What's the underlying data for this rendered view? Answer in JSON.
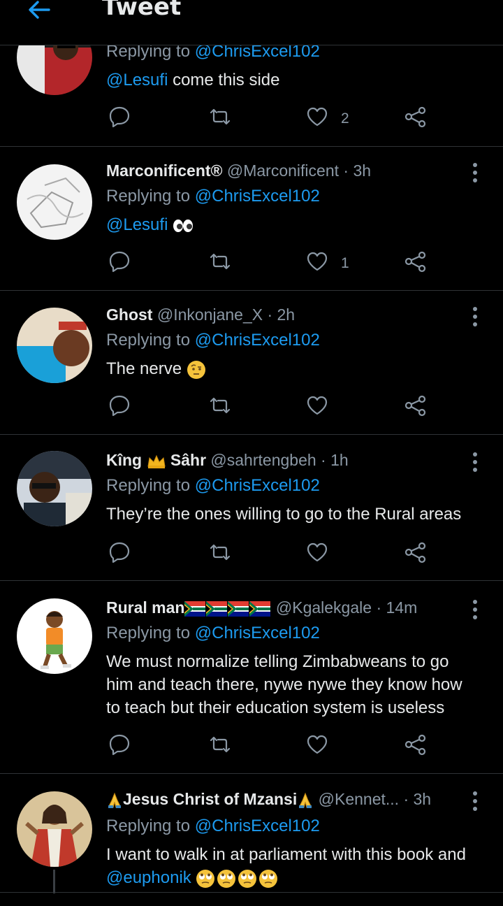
{
  "header": {
    "title": "Tweet",
    "back_icon": "arrow-left-icon",
    "accent": "#1d9bf0"
  },
  "colors": {
    "background": "#000000",
    "text": "#e7e9ea",
    "muted": "#8b98a5",
    "link": "#1d9bf0",
    "divider": "#2f3336"
  },
  "tweets": [
    {
      "replying_prefix": "Replying to",
      "replying_to": "@ChrisExcel102",
      "mention": "@Lesufi",
      "text": " come this side",
      "likes": "2"
    },
    {
      "name": "Marconificent®",
      "handle": "@Marconificent",
      "time": "· 3h",
      "replying_prefix": "Replying to",
      "replying_to": "@ChrisExcel102",
      "mention": "@Lesufi",
      "emoji": "eyes",
      "likes": "1"
    },
    {
      "name": "Ghost",
      "handle": "@Inkonjane_X",
      "time": "· 2h",
      "replying_prefix": "Replying to",
      "replying_to": "@ChrisExcel102",
      "text": "The nerve",
      "emoji": "face-with-raised-eyebrow"
    },
    {
      "name_a": "Kîng",
      "name_b": "Sâhr",
      "emoji": "crown",
      "handle": "@sahrtengbeh",
      "time": "· 1h",
      "replying_prefix": "Replying to",
      "replying_to": "@ChrisExcel102",
      "text": "They’re the ones willing to go to the Rural areas"
    },
    {
      "name": "Rural man",
      "emoji": "south-africa-flag x4",
      "handle": "@Kgalekgale",
      "time": "· 14m",
      "replying_prefix": "Replying to",
      "replying_to": "@ChrisExcel102",
      "text_lines": [
        "We must normalize telling Zimbabweans to go",
        "him and teach there, nywe nywe they know how",
        "to teach but their education system is useless"
      ]
    },
    {
      "name": "Jesus Christ of Mzansi",
      "emoji": "folded-hands x2",
      "handle": "@Kennet...",
      "time": "· 3h",
      "replying_prefix": "Replying to",
      "replying_to": "@ChrisExcel102",
      "text": "I want to walk in at parliament with this book and",
      "mention": "@euphonik",
      "trailing_emoji": "face-with-rolling-eyes x4"
    }
  ]
}
